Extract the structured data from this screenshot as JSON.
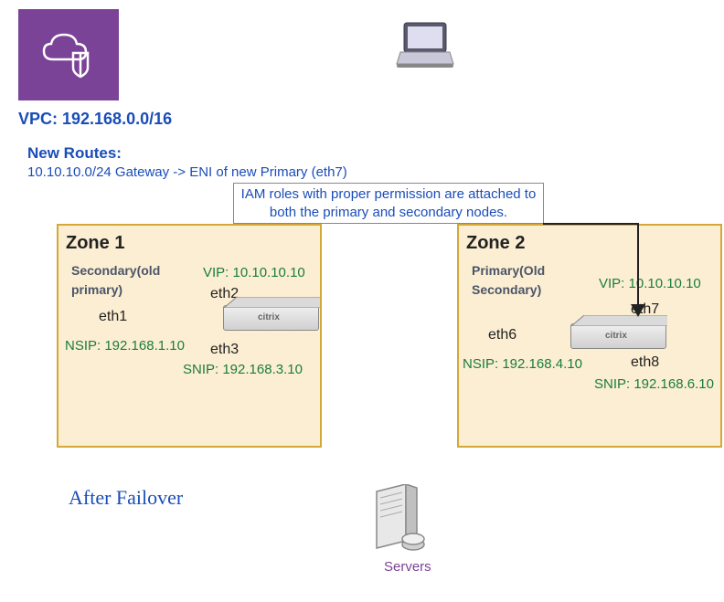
{
  "vpc": {
    "label": "VPC: 192.168.0.0/16"
  },
  "routes": {
    "header": "New Routes:",
    "detail": "10.10.10.0/24 Gateway -> ENI of new Primary (eth7)"
  },
  "iam_note": "IAM roles with proper permission are attached to both the primary and secondary nodes.",
  "zone1": {
    "title": "Zone 1",
    "role": "Secondary(old primary)",
    "vip": "VIP: 10.10.10.10",
    "eth_top_left": "eth1",
    "eth_top_right": "eth2",
    "eth_bottom": "eth3",
    "nsip": "NSIP: 192.168.1.10",
    "snip": "SNIP: 192.168.3.10",
    "brand": "citrix"
  },
  "zone2": {
    "title": "Zone 2",
    "role": "Primary(Old Secondary)",
    "vip": "VIP: 10.10.10.10",
    "eth_top_left": "eth6",
    "eth_top_right": "eth7",
    "eth_bottom": "eth8",
    "nsip": "NSIP: 192.168.4.10",
    "snip": "SNIP: 192.168.6.10",
    "brand": "citrix"
  },
  "after_failover": "After Failover",
  "servers_label": "Servers"
}
